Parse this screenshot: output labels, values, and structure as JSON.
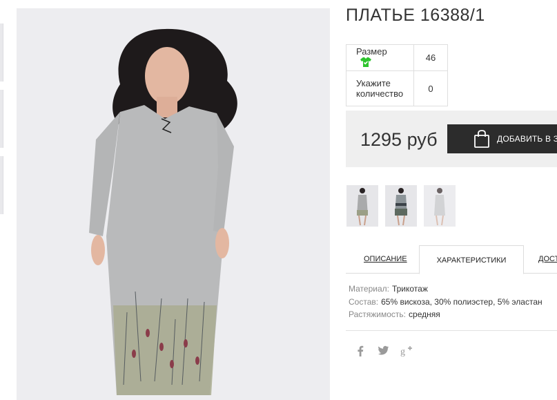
{
  "product": {
    "title": "ПЛАТЬЕ 16388/1",
    "price": "1295 руб",
    "add_to_cart_label": "ДОБАВИТЬ В ЗАКАЗ"
  },
  "options": {
    "size_label": "Размер",
    "size_value": "46",
    "qty_label": "Укажите количество",
    "qty_value": "0"
  },
  "tabs": [
    {
      "label": "ОПИСАНИЕ"
    },
    {
      "label": "ХАРАКТЕРИСТИКИ"
    },
    {
      "label": "ДОСТАВКА"
    }
  ],
  "characteristics": [
    {
      "key": "Материал:",
      "value": "Трикотаж"
    },
    {
      "key": "Состав:",
      "value": "65% вискоза, 30% полиэстер, 5% эластан"
    },
    {
      "key": "Растяжимость:",
      "value": "средняя"
    }
  ],
  "social": [
    "facebook-icon",
    "twitter-icon",
    "google-plus-icon"
  ],
  "colors": {
    "cart_button": "#2c2c2c",
    "price_bg": "#efefef",
    "size_icon": "#2ec42e"
  }
}
